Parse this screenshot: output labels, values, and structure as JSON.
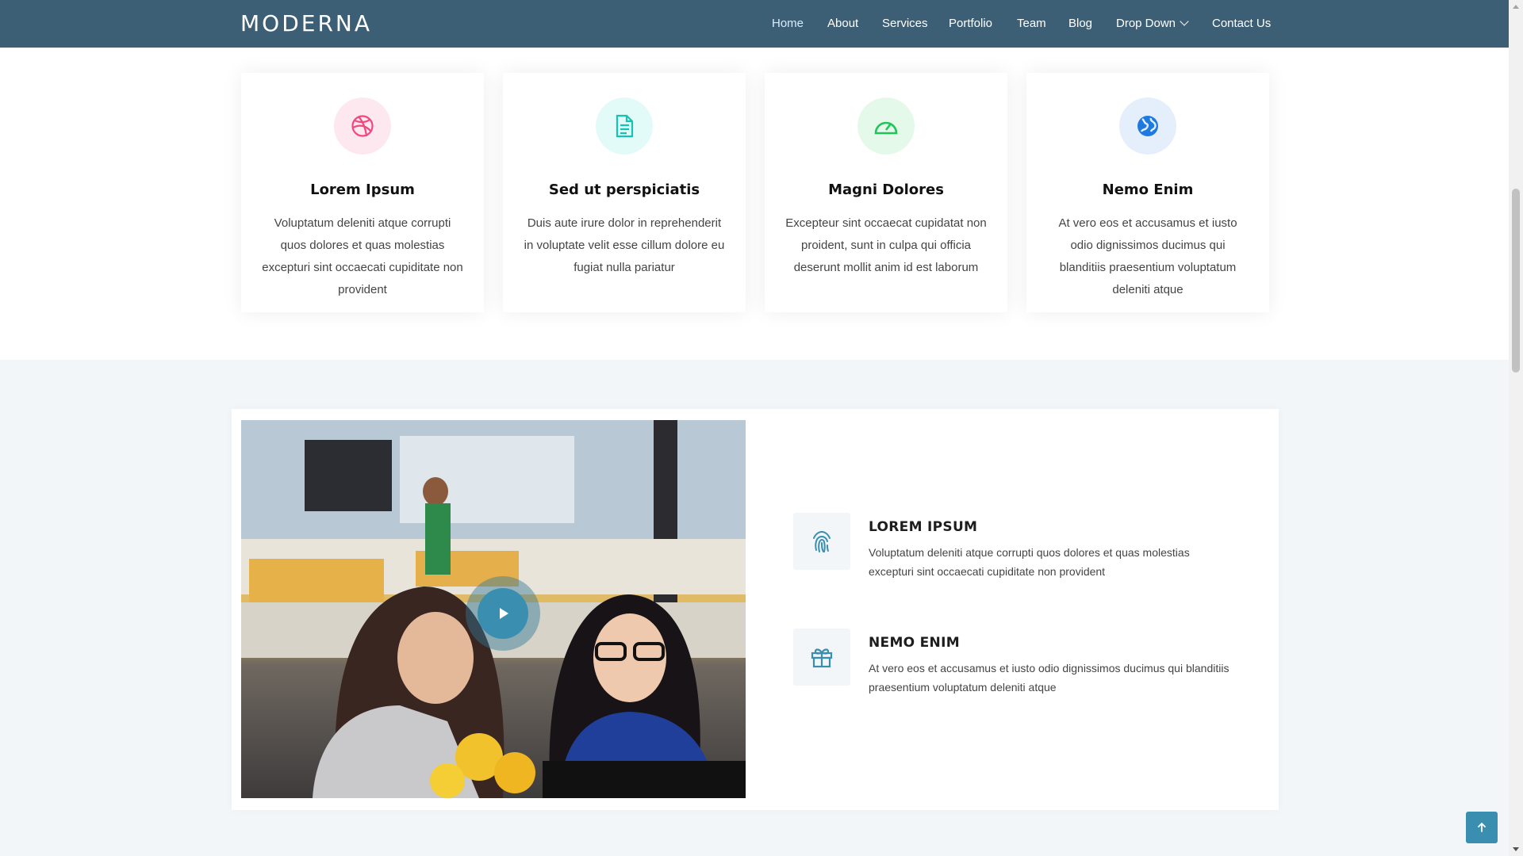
{
  "header": {
    "logo": "MODERNA",
    "nav": [
      {
        "label": "Home"
      },
      {
        "label": "About"
      },
      {
        "label": "Services"
      },
      {
        "label": "Portfolio"
      },
      {
        "label": "Team"
      },
      {
        "label": "Blog"
      },
      {
        "label": "Drop Down"
      },
      {
        "label": "Contact Us"
      }
    ],
    "active_nav": "Home"
  },
  "features": [
    {
      "icon": "dribbble-icon",
      "icon_color": "#f1487d",
      "bg_color": "#fde8ef",
      "title": "Lorem Ipsum",
      "text": "Voluptatum deleniti atque corrupti quos dolores et quas molestias excepturi sint occaecati cupiditate non provident"
    },
    {
      "icon": "document-icon",
      "icon_color": "#14c4b3",
      "bg_color": "#e3fbf8",
      "title": "Sed ut perspiciatis",
      "text": "Duis aute irure dolor in reprehenderit in voluptate velit esse cillum dolore eu fugiat nulla pariatur"
    },
    {
      "icon": "speedometer-icon",
      "icon_color": "#21c45b",
      "bg_color": "#e4f9ea",
      "title": "Magni Dolores",
      "text": "Excepteur sint occaecat cupidatat non proident, sunt in culpa qui officia deserunt mollit anim id est laborum"
    },
    {
      "icon": "globe-icon",
      "icon_color": "#1f7ae0",
      "bg_color": "#e5effc",
      "title": "Nemo Enim",
      "text": "At vero eos et accusamus et iusto odio dignissimos ducimus qui blanditiis praesentium voluptatum deleniti atque"
    }
  ],
  "why_us": {
    "items": [
      {
        "icon": "fingerprint-icon",
        "title": "LOREM IPSUM",
        "text": "Voluptatum deleniti atque corrupti quos dolores et quas molestias excepturi sint occaecati cupiditate non provident"
      },
      {
        "icon": "gift-icon",
        "title": "NEMO ENIM",
        "text": "At vero eos et accusamus et iusto odio dignissimos ducimus qui blanditiis praesentium voluptatum deleniti atque"
      }
    ]
  },
  "colors": {
    "header_bg": "#3d5f76",
    "accent": "#3a8fb0",
    "section_bg": "#f2f6f9"
  }
}
